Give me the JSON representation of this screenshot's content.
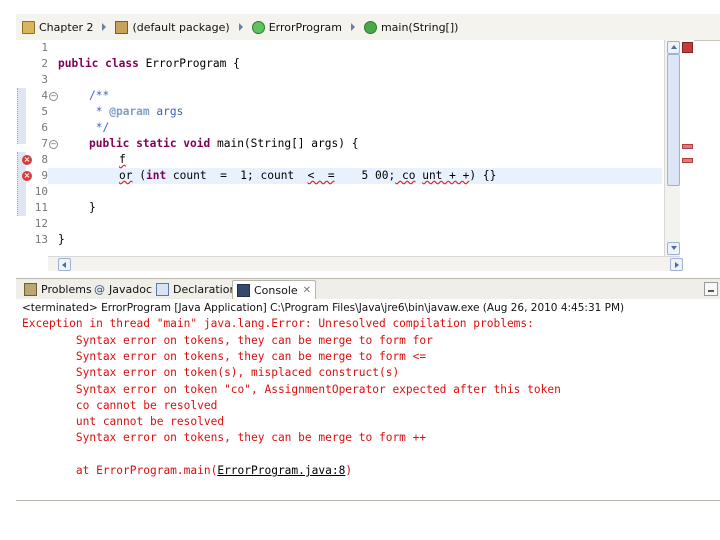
{
  "breadcrumb": {
    "items": [
      "Chapter 2",
      "(default package)",
      "ErrorProgram",
      "main(String[])"
    ]
  },
  "editor": {
    "line_numbers": [
      "1",
      "2",
      "3",
      "4",
      "5",
      "6",
      "7",
      "8",
      "9",
      "10",
      "11",
      "12",
      "13"
    ],
    "lines": {
      "l2_kw": "public class",
      "l2_rest": " ErrorProgram {",
      "l4": "/**",
      "l5_star": " * ",
      "l5_tag": "@param",
      "l5_rest": " args",
      "l6": " */",
      "l7_kw": "public static void",
      "l7_rest": " main(String[] args) {",
      "l8_err": "f",
      "l9_pre": "",
      "l9_or": "or",
      "l9_mid1": " (",
      "l9_int": "int",
      "l9_mid2": " count  =  1; count  ",
      "l9_lt": "<  =",
      "l9_mid3": "    ",
      "l9_500": "5 00;",
      "l9_co": " co",
      "l9_sp": " ",
      "l9_unt": "unt + +",
      "l9_end": ") {}",
      "l11": "}",
      "l13": "}"
    }
  },
  "bottom_tabs": [
    {
      "label": "Problems"
    },
    {
      "label": "Javadoc"
    },
    {
      "label": "Declaration"
    },
    {
      "label": "Console"
    }
  ],
  "console": {
    "header": "<terminated> ErrorProgram [Java Application] C:\\Program Files\\Java\\jre6\\bin\\javaw.exe (Aug 26, 2010 4:45:31 PM)",
    "lines": [
      "Exception in thread \"main\" java.lang.Error: Unresolved compilation problems:",
      "        Syntax error on tokens, they can be merge to form for",
      "        Syntax error on tokens, they can be merge to form <=",
      "        Syntax error on token(s), misplaced construct(s)",
      "        Syntax error on token \"co\", AssignmentOperator expected after this token",
      "        co cannot be resolved",
      "        unt cannot be resolved",
      "        Syntax error on tokens, they can be merge to form ++"
    ],
    "stack_prefix": "        at ErrorProgram.main(",
    "stack_link": "ErrorProgram.java:8",
    "stack_suffix": ")"
  }
}
